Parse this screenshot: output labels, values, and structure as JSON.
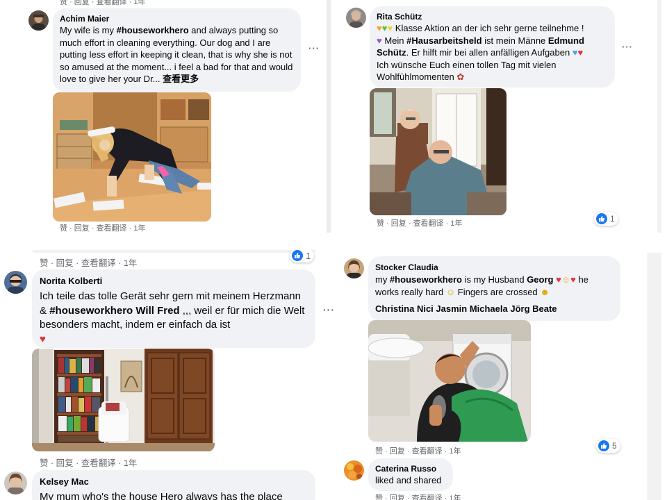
{
  "colors": {
    "link_blue": "#1877f2",
    "bubble": "#f0f2f5",
    "meta": "#65676b"
  },
  "action_labels": {
    "like": "赞",
    "reply": "回复",
    "translate": "查看翻译",
    "sep": " · "
  },
  "comments": [
    {
      "id": "achim",
      "author": "Achim Maier",
      "text": "My wife is my #houseworkhero and always putting so much effort in cleaning everything. Our dog and I are putting less effort in keeping it clean, that is why she is not so amused at the moment... i feel a bad for that and would love to give her your Dr...",
      "hashtag": "#houseworkhero",
      "see_more": "查看更多",
      "time": "1年",
      "top_time": "1年"
    },
    {
      "id": "rita",
      "author": "Rita Schütz",
      "line1": "Klasse Aktion an der ich sehr gerne teilnehme !",
      "line2a": "Mein ",
      "hashtag": "#Hausarbeitsheld",
      "line2b": " ist mein Männe ",
      "mention": "Edmund Schütz",
      "line3": ". Er hilft mir bei allen anfälligen Aufgaben ",
      "line4": "Ich wünsche Euch einen tollen Tag mit vielen Wohlfühlmomenten",
      "time": "1年",
      "likes": "1"
    },
    {
      "id": "norita",
      "author": "Norita Kolberti",
      "line1": "Ich teile das tolle Gerät sehr gern mit meinem Herzmann & ",
      "hashtag": "#houseworkhero",
      "mention": "Will Fred",
      "line2": " ,,, weil er für mich die Welt besonders macht, indem er einfach da ist",
      "time": "1年",
      "top_time": "1年",
      "top_likes": "1"
    },
    {
      "id": "claudia",
      "author": "Stocker Claudia",
      "text_a": "my ",
      "hashtag": "#houseworkhero",
      "text_b": " is my Husband ",
      "mention": "Georg",
      "text_c": " he works really hard ",
      "text_d": " Fingers are crossed ",
      "tags": "Christina Nici Jasmin Michaela Jörg Beate",
      "time": "1年",
      "likes": "5"
    },
    {
      "id": "caterina",
      "author": "Caterina Russo",
      "text": "liked and shared",
      "time": "1年"
    },
    {
      "id": "kelsey",
      "author": "Kelsey Mac",
      "text": "My mum who's the house Hero always has the place"
    }
  ]
}
